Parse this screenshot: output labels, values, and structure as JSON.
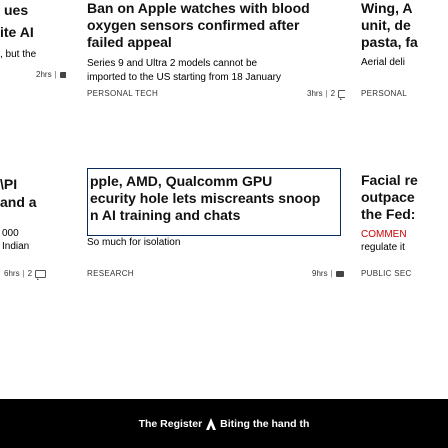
{
  "left_col": {
    "top": {
      "headline": "ues",
      "sub1": "ite AI",
      "sub2": ", but the",
      "meta_time": "2hrs",
      "meta_sep": "|"
    },
    "bottom": {
      "headline1": "\\PI",
      "headline2": "and a",
      "sub1": "000",
      "sub2": "Indian",
      "meta_time": "6hrs",
      "meta_sep": "|",
      "meta_count": "2"
    }
  },
  "center_col": {
    "top": {
      "headline": "Ban on Apple watches with blood oxygen sensors confirmed after failed appeal",
      "headline_lines": [
        "Ban on Apple watches with blood",
        "oxygen sensors confirmed after",
        "failed appeal"
      ],
      "sub_lines": [
        "Series 9 and Ultra 2 models cannot be",
        "imported to the US starting from 18 January"
      ],
      "category": "PERSONAL TECH",
      "meta_time": "3hrs",
      "meta_sep": "|",
      "meta_count": "2"
    },
    "bottom": {
      "headline_lines": [
        "pple, AMD, Qualcomm GPU",
        "ecurity hole lets miscreants snoop",
        "n AI training and chats"
      ],
      "sub": "So much for isolation",
      "category": "RESEARCH",
      "meta_time": "9hrs",
      "meta_sep": "|"
    }
  },
  "right_col": {
    "top": {
      "headline_lines": [
        "Wing, A",
        "unit, de",
        "pasta, fa"
      ],
      "sub": "Aerial deli",
      "category": "PERSONAL"
    },
    "bottom": {
      "headline_lines": [
        "Facial re",
        "outpace",
        "the Fed:"
      ],
      "sub": "regulate it",
      "category_lines": [
        "COMMEN"
      ],
      "category": "PUBLIC SEC"
    }
  },
  "footer": {
    "text_before": "The Register",
    "icon": "vulture-logo-icon",
    "text_after": "Biting the hand th"
  },
  "colors": {
    "red_link": "#cc0000",
    "footer_bg": "#000000",
    "box_border": "#0a2a5c"
  }
}
